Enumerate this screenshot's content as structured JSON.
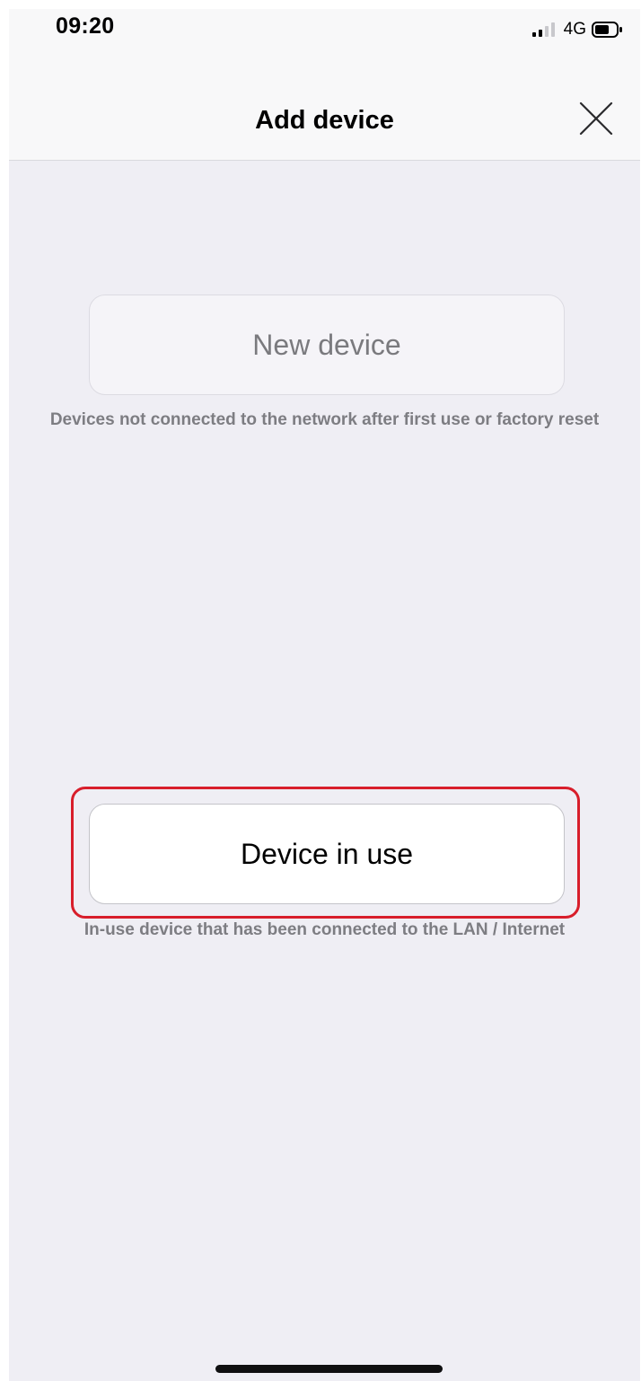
{
  "status_bar": {
    "time": "09:20",
    "network": "4G",
    "signal_bars_active": 2,
    "signal_bars_total": 4
  },
  "header": {
    "title": "Add device",
    "close_icon": "close-icon"
  },
  "options": [
    {
      "label": "New device",
      "description": "Devices not connected to the network after first use or factory reset",
      "state": "inactive"
    },
    {
      "label": "Device in use",
      "description": "In-use device that has been connected to the LAN / Internet",
      "state": "highlighted"
    }
  ],
  "colors": {
    "background": "#efeef4",
    "header_background": "#f8f8f9",
    "highlight_border": "#d81e2b",
    "secondary_text": "#7d7d82",
    "inactive_label": "#7a7a7e"
  }
}
